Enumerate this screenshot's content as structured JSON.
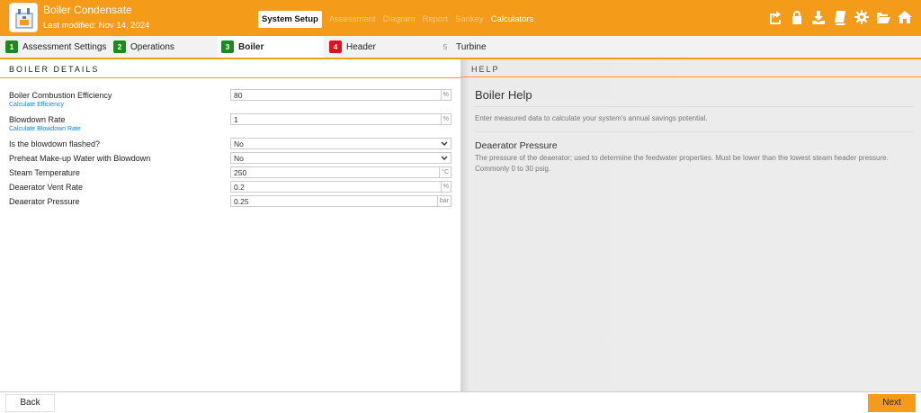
{
  "header": {
    "title": "Boiler Condensate",
    "last_modified": "Last modified: Nov 14, 2024",
    "nav": [
      {
        "label": "System Setup",
        "state": "active"
      },
      {
        "label": "Assessment",
        "state": "disabled"
      },
      {
        "label": "Diagram",
        "state": "disabled"
      },
      {
        "label": "Report",
        "state": "disabled"
      },
      {
        "label": "Sankey",
        "state": "disabled"
      },
      {
        "label": "Calculators",
        "state": "enabled"
      }
    ],
    "tools": [
      "share-icon",
      "lock-icon",
      "download-icon",
      "book-icon",
      "gear-icon",
      "folder-open-icon",
      "home-icon"
    ]
  },
  "tabs": [
    {
      "num": "1",
      "label": "Assessment Settings",
      "status": "complete"
    },
    {
      "num": "2",
      "label": "Operations",
      "status": "complete"
    },
    {
      "num": "3",
      "label": "Boiler",
      "status": "complete"
    },
    {
      "num": "4",
      "label": "Header",
      "status": "error"
    },
    {
      "num": "5",
      "label": "Turbine",
      "status": "pending"
    }
  ],
  "form": {
    "section_title": "BOILER DETAILS",
    "fields": [
      {
        "label": "Boiler Combustion Efficiency",
        "value": "80",
        "unit": "%",
        "link": "Calculate Efficiency"
      },
      {
        "label": "Blowdown Rate",
        "value": "1",
        "unit": "%",
        "link": "Calculate Blowdown Rate"
      },
      {
        "label": "Is the blowdown flashed?",
        "value": "No",
        "type": "select"
      },
      {
        "label": "Preheat Make-up Water with Blowdown",
        "value": "No",
        "type": "select"
      },
      {
        "label": "Steam Temperature",
        "value": "250",
        "unit": "°C"
      },
      {
        "label": "Deaerator Vent Rate",
        "value": "0.2",
        "unit": "%"
      },
      {
        "label": "Deaerator Pressure",
        "value": "0.25",
        "unit": "bar"
      }
    ]
  },
  "help": {
    "section_title": "HELP",
    "heading": "Boiler Help",
    "intro": "Enter measured data to calculate your system's annual savings potential.",
    "topic": "Deaerator Pressure",
    "description": "The pressure of the deaerator; used to determine the feedwater properties. Must be lower than the lowest steam header pressure. Commonly 0 to 30 psig."
  },
  "footer": {
    "back": "Back",
    "next": "Next"
  },
  "colors": {
    "accent": "#f49b1a",
    "tab_complete": "#1d8a21",
    "tab_error": "#e0101f",
    "link": "#1b7ed1"
  }
}
